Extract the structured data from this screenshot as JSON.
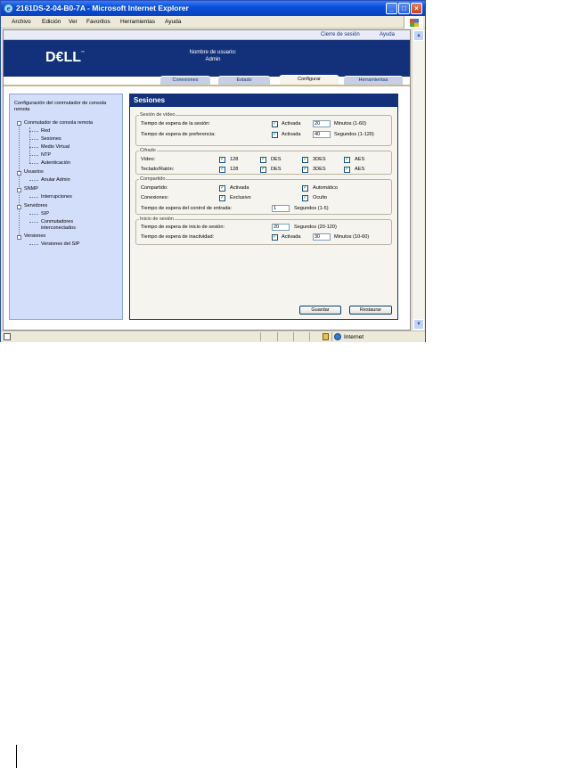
{
  "window": {
    "title": "2161DS-2-04-B0-7A - Microsoft Internet Explorer"
  },
  "menu": [
    "Archivo",
    "Edición",
    "Ver",
    "Favoritos",
    "Herramientas",
    "Ayuda"
  ],
  "toplinks": {
    "logout": "Cierre de sesión",
    "help": "Ayuda"
  },
  "header": {
    "logo": "D€LL",
    "user_label": "Nombre de usuario:",
    "user_value": "Admin"
  },
  "tabs": [
    "Conexiones",
    "Estado",
    "Configurar",
    "Herramientas"
  ],
  "sidebar": {
    "heading": "Configuración del conmutador de consola remota",
    "items": {
      "conmutador": "Conmutador de consola remota",
      "red": "Red",
      "sesiones": "Sesiones",
      "medio": "Medio Virtual",
      "ntp": "NTP",
      "autenticacion": "Autenticación",
      "usuarios": "Usuarios",
      "anular": "Anular Admin",
      "snmp": "SNMP",
      "interrupciones": "Interrupciones",
      "servidores": "Servidores",
      "sip": "SIP",
      "conmutadores1": "Conmutadores",
      "conmutadores2": "interconectados",
      "versiones": "Versiones",
      "versiones_sip": "Versiones del SIP"
    }
  },
  "panel": {
    "title": "Sesiones",
    "video": {
      "legend": "Sesión de vídeo",
      "timeout_label": "Tiempo de espera de la sesión:",
      "timeout_check": "Activada",
      "timeout_value": "20",
      "timeout_unit": "Minutos (1-60)",
      "pref_label": "Tiempo de espera de preferencia:",
      "pref_check": "Activada",
      "pref_value": "40",
      "pref_unit": "Segundos (1-120)"
    },
    "cifrado": {
      "legend": "Cifrado",
      "video_label": "Vídeo:",
      "kbd_label": "Teclado/Ratón:",
      "options": [
        "128",
        "DES",
        "3DES",
        "AES"
      ]
    },
    "compartido": {
      "legend": "Compartido",
      "share_label": "Compartido:",
      "share_active": "Activada",
      "share_auto": "Automático",
      "conn_label": "Conexiones:",
      "conn_excl": "Exclusivo",
      "conn_hidden": "Oculto",
      "input_label": "Tiempo de espera del control de entrada:",
      "input_value": "1",
      "input_unit": "Segundos (1-5)"
    },
    "login": {
      "legend": "Inicio de sesión",
      "login_label": "Tiempo de espera de inicio de sesión:",
      "login_value": "20",
      "login_unit": "Segundos (20-120)",
      "idle_label": "Tiempo de espera de inactividad:",
      "idle_check": "Activada",
      "idle_value": "30",
      "idle_unit": "Minutos (10-60)"
    },
    "buttons": {
      "save": "Guardar",
      "restore": "Restaurar"
    }
  },
  "status": {
    "zone": "Internet"
  }
}
